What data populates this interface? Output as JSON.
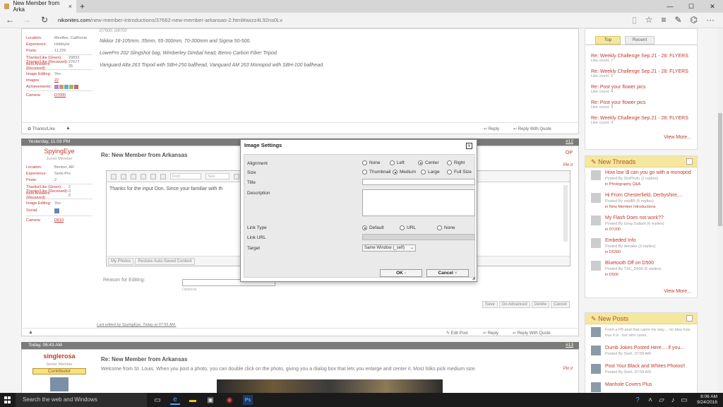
{
  "browser": {
    "tab_title": "New Member from Arka",
    "tab_close": "×",
    "new_tab": "+",
    "url_domain": "nikonites.com",
    "url_path": "/new-member-introductions/37662-new-member-arkansas-2.html#axzz4L92ns0Lv",
    "win_min": "—",
    "win_max": "☐",
    "win_close": "✕"
  },
  "post11": {
    "location_label": "Location:",
    "location_value": "Menifee, California",
    "experience_label": "Experience:",
    "experience_value": "Hobbyist",
    "posts_label": "Posts:",
    "posts_value": "11,225",
    "thanks_given_label": "Thanks/Like (Given):",
    "thanks_given_value": "29833",
    "thanks_received_label": "Thanks/Like (Received):",
    "thanks_received_value": "27677",
    "best_answers_label": "Best Answers (Received):",
    "best_answers_value": "35",
    "image_editing_label": "Image Editing:",
    "image_editing_value": "Yes",
    "images_label": "Images:",
    "images_value": "22",
    "achievements_label": "Achievements:",
    "camera_label": "Camera:",
    "camera_value": "D7000",
    "line0": "D7000, D8700",
    "line1": "Nikkor 18-105mm, 35mm, 55-300mm, 70-300mm and Sigma 50-500.",
    "line2": "LowePro 202 Slingshot bag, Wimberley Gimbal head, Benro Carbon Fiber Tripod.",
    "line3": "Vanguard Alta 263 Tripod with SBH-250 ballhead, Vanguard AM 263 Monopod with SBH-100 ballhead.",
    "thanks_like": "Thanks/Like",
    "reply": "Reply",
    "reply_quote": "Reply With Quote"
  },
  "post12": {
    "header_date": "Yesterday, 11:03 PM",
    "number": "#12",
    "username": "SpyingEye",
    "rank": "Junior Member",
    "title": "Re: New Member from Arkansas",
    "op": "OP",
    "pin": "Pin it",
    "location_label": "Location:",
    "location_value": "Benton, AR",
    "experience_label": "Experience:",
    "experience_value": "Semi-Pro",
    "posts_label": "Posts:",
    "posts_value": "2",
    "thanks_given_label": "Thanks/Like (Given):",
    "thanks_given_value": "2",
    "thanks_received_label": "Thanks/Like (Received):",
    "thanks_received_value": "0",
    "best_answers_label": "Best Answers (Received):",
    "best_answers_value": "0",
    "image_editing_label": "Image Editing:",
    "image_editing_value": "Yes",
    "social_label": "Social:",
    "camera_label": "Camera:",
    "camera_value": "D610",
    "editor_text": "Thanks for the input Don. Since your familiar with th",
    "font_placeholder": "Font",
    "size_placeholder": "Size",
    "my_photos": "My Photos",
    "restore_autosave": "Restore Auto-Saved Content",
    "reason_label": "Reason for Editing:",
    "optional": "Optional",
    "save": "Save",
    "go_advanced": "Go Advanced",
    "delete": "Delete",
    "cancel": "Cancel",
    "last_edited": "Last edited by SpyingEye; Today at 07:55 AM.",
    "edit_post": "Edit Post",
    "reply": "Reply",
    "reply_quote": "Reply With Quote"
  },
  "post13": {
    "header_date": "Today, 06:43 AM",
    "number": "#13",
    "username": "singlerosa",
    "rank": "Senior Member",
    "badge": "Contributor",
    "title": "Re: New Member from Arkansas",
    "pin": "Pin it",
    "body": "Welcome from St. Louis. When you post a photo, you can double click on the photo, giving you a dialog box that lets you enlarge and center it. Most folks pick medium size."
  },
  "dialog": {
    "title": "Image Settings",
    "close": "x",
    "alignment_label": "Alignment",
    "alignment_options": [
      "None",
      "Left",
      "Center",
      "Right"
    ],
    "size_label": "Size",
    "size_options": [
      "Thumbnail",
      "Medium",
      "Large",
      "Full Size"
    ],
    "title_label": "Title",
    "description_label": "Description",
    "link_type_label": "Link Type",
    "link_type_options": [
      "Default",
      "URL",
      "None"
    ],
    "link_url_label": "Link URL",
    "target_label": "Target",
    "target_value": "Same Window (_self)",
    "ok": "OK",
    "cancel": "Cancel"
  },
  "sidebar": {
    "tab_top": "Top",
    "tab_recent": "Recent",
    "top_items": [
      {
        "title": "Re: Weekly Challenge Sep.21 - 28: FLYERS",
        "meta": "Like count: 7"
      },
      {
        "title": "Re: Weekly Challenge Sep.21 - 28: FLYERS",
        "meta": "Like count: 5"
      },
      {
        "title": "Re: Post your flower pics",
        "meta": "Like count: 4"
      },
      {
        "title": "Re: Post your flower pics",
        "meta": "Like count: 4"
      },
      {
        "title": "Re: Weekly Challenge Sep.21 - 28: FLYERS",
        "meta": "Like count: 4"
      }
    ],
    "view_more": "View More...",
    "new_threads_title": "New Threads",
    "threads": [
      {
        "title": "How low \\$ can you go with a monopod",
        "by": "Posted By StoPhoto (2 replies)",
        "in": "in Photography Q&A"
      },
      {
        "title": "Hi From Chesterfield, Derbyshire,...",
        "by": "Posted By osbl85 (5 replies)",
        "in": "in New Member Introductions"
      },
      {
        "title": "My Flash Does not work??",
        "by": "Posted By Greg Gallant (6 replies)",
        "in": "in D7200"
      },
      {
        "title": "Embeded Info",
        "by": "Posted By derrabe (3 replies)",
        "in": "in D5300"
      },
      {
        "title": "Bluetooth Off on D500",
        "by": "Posted By TXC_D500 (6 replies)",
        "in": "in D500"
      }
    ],
    "new_posts_title": "New Posts",
    "posts": [
      {
        "title": "From a FB post that came my way.... no idea how true it is - but who cares.",
        "by": ""
      },
      {
        "title": "Dumb Jokes Posted Here.... if you...",
        "by": "Posted By Swirl, 07:59 AM"
      },
      {
        "title": "Post Your Black and Whites Photos!!",
        "by": "Posted By Swirl, 07:59 AM"
      },
      {
        "title": "Manhole Covers Plus",
        "by": ""
      }
    ]
  },
  "taskbar": {
    "search_placeholder": "Search the web and Windows",
    "time": "8:06 AM",
    "date": "9/24/2016"
  }
}
